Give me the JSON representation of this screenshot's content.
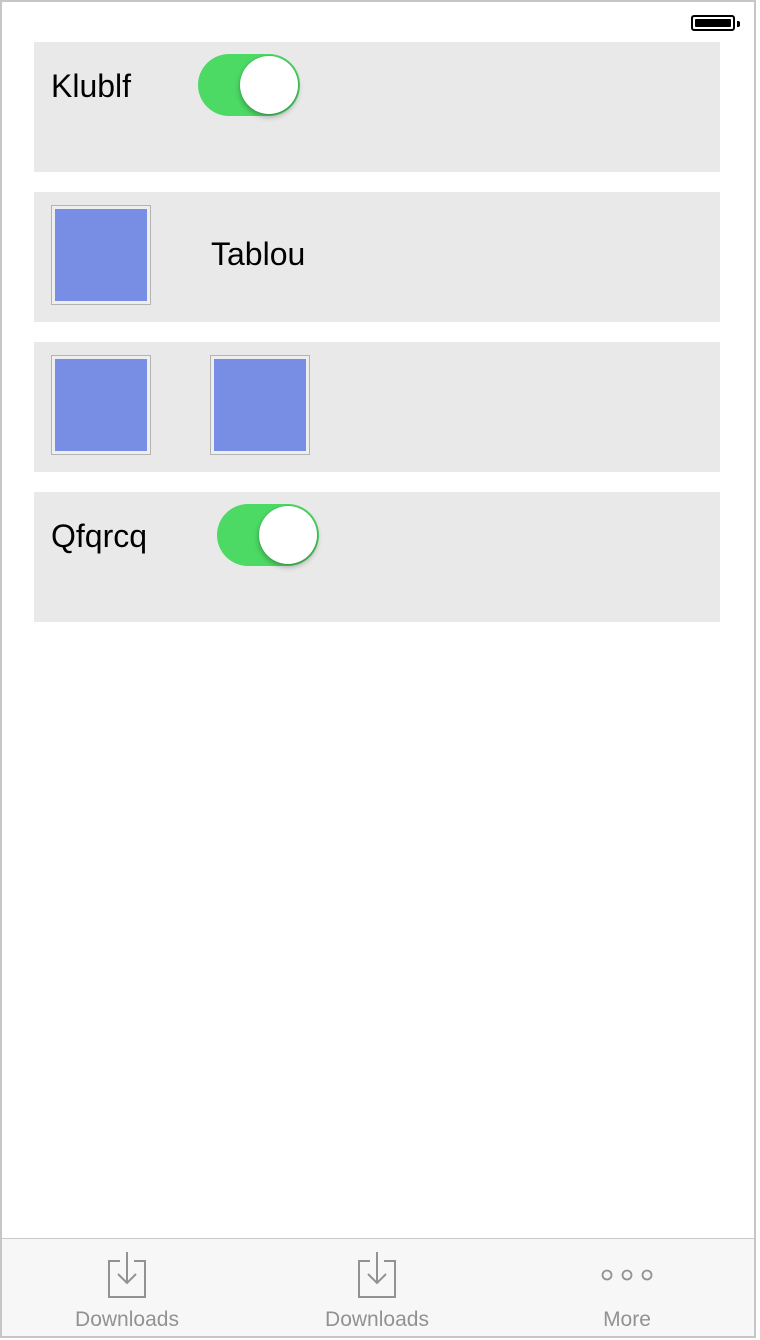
{
  "status_bar": {
    "battery_icon": "battery-full-icon"
  },
  "cells": {
    "row1": {
      "label": "Klublf",
      "toggle_on": true
    },
    "row2": {
      "label": "Tablou",
      "tile_color": "#788ee5"
    },
    "row3": {
      "tile_color": "#788ee5"
    },
    "row4": {
      "label": "Qfqrcq",
      "toggle_on": true
    }
  },
  "colors": {
    "toggle_on": "#4cd964",
    "cell_background": "#e9e9e9",
    "tile": "#788ee5",
    "tab_inactive": "#929292"
  },
  "tabbar": {
    "tabs": [
      {
        "label": "Downloads",
        "icon": "download-icon"
      },
      {
        "label": "Downloads",
        "icon": "download-icon"
      },
      {
        "label": "More",
        "icon": "more-icon"
      }
    ]
  }
}
